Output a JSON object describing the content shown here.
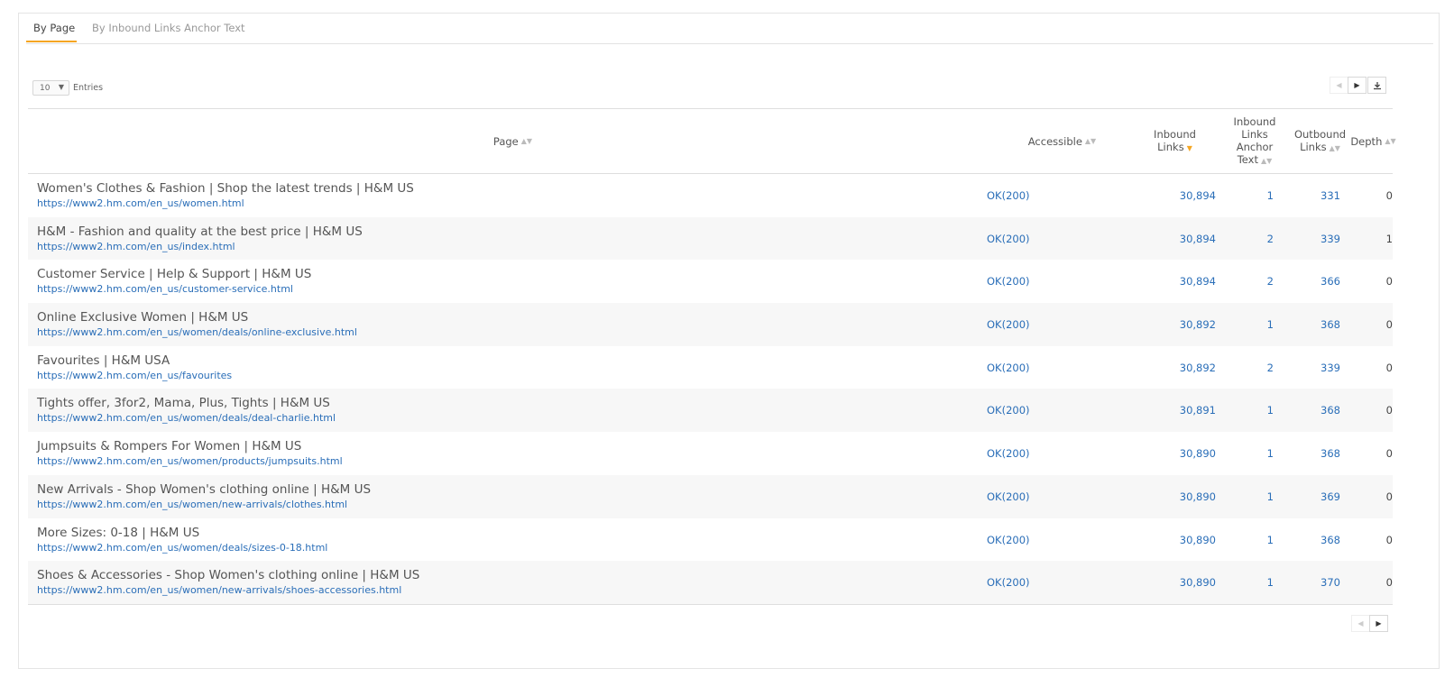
{
  "tabs": [
    {
      "label": "By Page",
      "active": true
    },
    {
      "label": "By Inbound Links Anchor Text",
      "active": false
    }
  ],
  "entries": {
    "value": "10",
    "label": "Entries"
  },
  "columns": {
    "page": "Page",
    "accessible": "Accessible",
    "inbound_links": [
      "Inbound",
      "Links"
    ],
    "anchor_text": [
      "Inbound",
      "Links",
      "Anchor",
      "Text"
    ],
    "outbound_links": [
      "Outbound",
      "Links"
    ],
    "depth": "Depth"
  },
  "rows": [
    {
      "title": "Women's Clothes & Fashion | Shop the latest trends | H&M US",
      "url": "https://www2.hm.com/en_us/women.html",
      "accessible": "OK(200)",
      "inbound": "30,894",
      "anchor": "1",
      "outbound": "331",
      "depth": "0"
    },
    {
      "title": "H&M - Fashion and quality at the best price | H&M US",
      "url": "https://www2.hm.com/en_us/index.html",
      "accessible": "OK(200)",
      "inbound": "30,894",
      "anchor": "2",
      "outbound": "339",
      "depth": "1"
    },
    {
      "title": "Customer Service | Help & Support | H&M US",
      "url": "https://www2.hm.com/en_us/customer-service.html",
      "accessible": "OK(200)",
      "inbound": "30,894",
      "anchor": "2",
      "outbound": "366",
      "depth": "0"
    },
    {
      "title": "Online Exclusive Women | H&M US",
      "url": "https://www2.hm.com/en_us/women/deals/online-exclusive.html",
      "accessible": "OK(200)",
      "inbound": "30,892",
      "anchor": "1",
      "outbound": "368",
      "depth": "0"
    },
    {
      "title": "Favourites | H&M USA",
      "url": "https://www2.hm.com/en_us/favourites",
      "accessible": "OK(200)",
      "inbound": "30,892",
      "anchor": "2",
      "outbound": "339",
      "depth": "0"
    },
    {
      "title": "Tights offer, 3for2, Mama, Plus, Tights | H&M US",
      "url": "https://www2.hm.com/en_us/women/deals/deal-charlie.html",
      "accessible": "OK(200)",
      "inbound": "30,891",
      "anchor": "1",
      "outbound": "368",
      "depth": "0"
    },
    {
      "title": "Jumpsuits & Rompers For Women | H&M US",
      "url": "https://www2.hm.com/en_us/women/products/jumpsuits.html",
      "accessible": "OK(200)",
      "inbound": "30,890",
      "anchor": "1",
      "outbound": "368",
      "depth": "0"
    },
    {
      "title": "New Arrivals - Shop Women's clothing online | H&M US",
      "url": "https://www2.hm.com/en_us/women/new-arrivals/clothes.html",
      "accessible": "OK(200)",
      "inbound": "30,890",
      "anchor": "1",
      "outbound": "369",
      "depth": "0"
    },
    {
      "title": "More Sizes: 0-18 | H&M US",
      "url": "https://www2.hm.com/en_us/women/deals/sizes-0-18.html",
      "accessible": "OK(200)",
      "inbound": "30,890",
      "anchor": "1",
      "outbound": "368",
      "depth": "0"
    },
    {
      "title": "Shoes & Accessories - Shop Women's clothing online | H&M US",
      "url": "https://www2.hm.com/en_us/women/new-arrivals/shoes-accessories.html",
      "accessible": "OK(200)",
      "inbound": "30,890",
      "anchor": "1",
      "outbound": "370",
      "depth": "0"
    }
  ],
  "colors": {
    "accent": "#f5a623",
    "link": "#2a6eb8"
  }
}
